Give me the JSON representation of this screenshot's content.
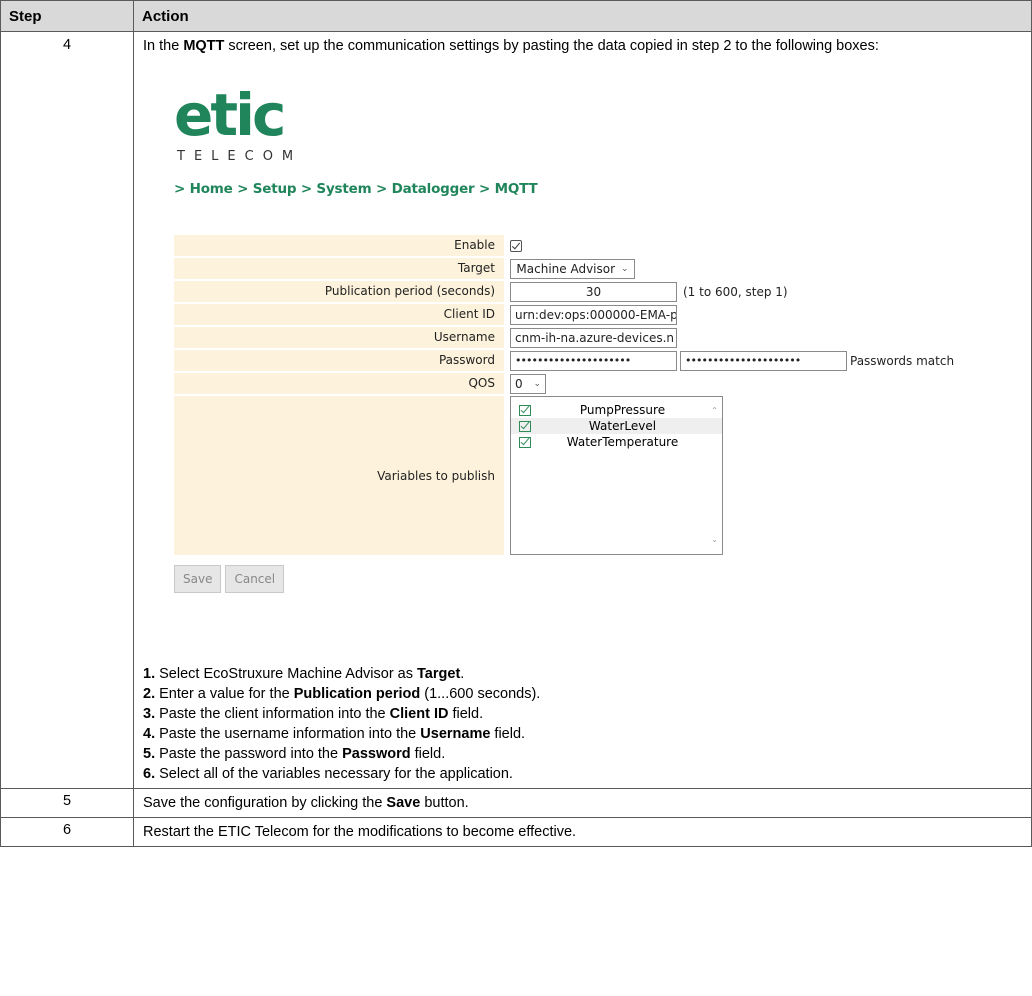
{
  "header": {
    "step": "Step",
    "action": "Action"
  },
  "row4": {
    "step": "4",
    "intro_pre": "In the ",
    "intro_bold": "MQTT",
    "intro_post": " screen, set up the communication settings by pasting the data copied in step 2 to the following boxes:",
    "screenshot": {
      "logo_word": "etic",
      "logo_sub": "TELECOM",
      "breadcrumb": "> Home > Setup > System > Datalogger > MQTT",
      "fields": {
        "enable_label": "Enable",
        "target_label": "Target",
        "target_value": "Machine Advisor",
        "period_label": "Publication period (seconds)",
        "period_value": "30",
        "period_hint": "(1 to 600, step 1)",
        "client_label": "Client ID",
        "client_value": "urn:dev:ops:000000-EMA-p",
        "username_label": "Username",
        "username_value": "cnm-ih-na.azure-devices.n",
        "password_label": "Password",
        "password_mask": "•••••••••••••••••••••",
        "password_confirm_mask": "•••••••••••••••••••••",
        "password_match": "Passwords match",
        "qos_label": "QOS",
        "qos_value": "0",
        "vars_label": "Variables to publish",
        "vars": [
          "PumpPressure",
          "WaterLevel",
          "WaterTemperature"
        ]
      },
      "buttons": {
        "save": "Save",
        "cancel": "Cancel"
      }
    },
    "steps": [
      {
        "num": "1.",
        "pre": " Select EcoStruxure Machine Advisor as ",
        "bold": "Target",
        "post": "."
      },
      {
        "num": "2.",
        "pre": " Enter a value for the ",
        "bold": "Publication period",
        "post": " (1...600 seconds)."
      },
      {
        "num": "3.",
        "pre": " Paste the client information into the ",
        "bold": "Client ID",
        "post": " field."
      },
      {
        "num": "4.",
        "pre": " Paste the username information into the ",
        "bold": "Username",
        "post": " field."
      },
      {
        "num": "5.",
        "pre": " Paste the password into the ",
        "bold": "Password",
        "post": " field."
      },
      {
        "num": "6.",
        "pre": " Select all of the variables necessary for the application.",
        "bold": "",
        "post": ""
      }
    ]
  },
  "row5": {
    "step": "5",
    "pre": "Save the configuration by clicking the ",
    "bold": "Save",
    "post": " button."
  },
  "row6": {
    "step": "6",
    "text": "Restart the ETIC Telecom for the modifications to become effective."
  }
}
